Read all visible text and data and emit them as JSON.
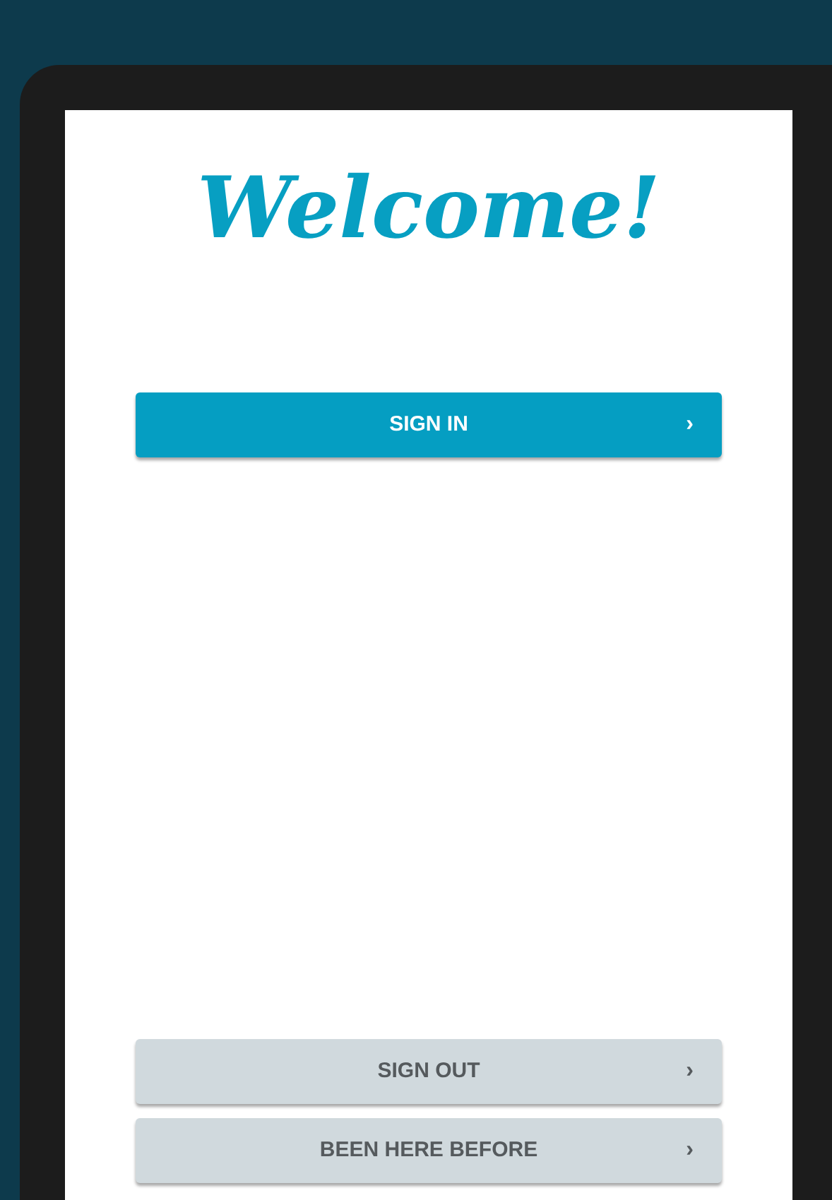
{
  "heading": "Welcome!",
  "buttons": [
    {
      "label": "SIGN IN",
      "chevron": "›",
      "kind": "primary"
    },
    {
      "label": "SIGN OUT",
      "chevron": "›",
      "kind": "secondary"
    },
    {
      "label": "BEEN HERE BEFORE",
      "chevron": "›",
      "kind": "secondary"
    }
  ]
}
